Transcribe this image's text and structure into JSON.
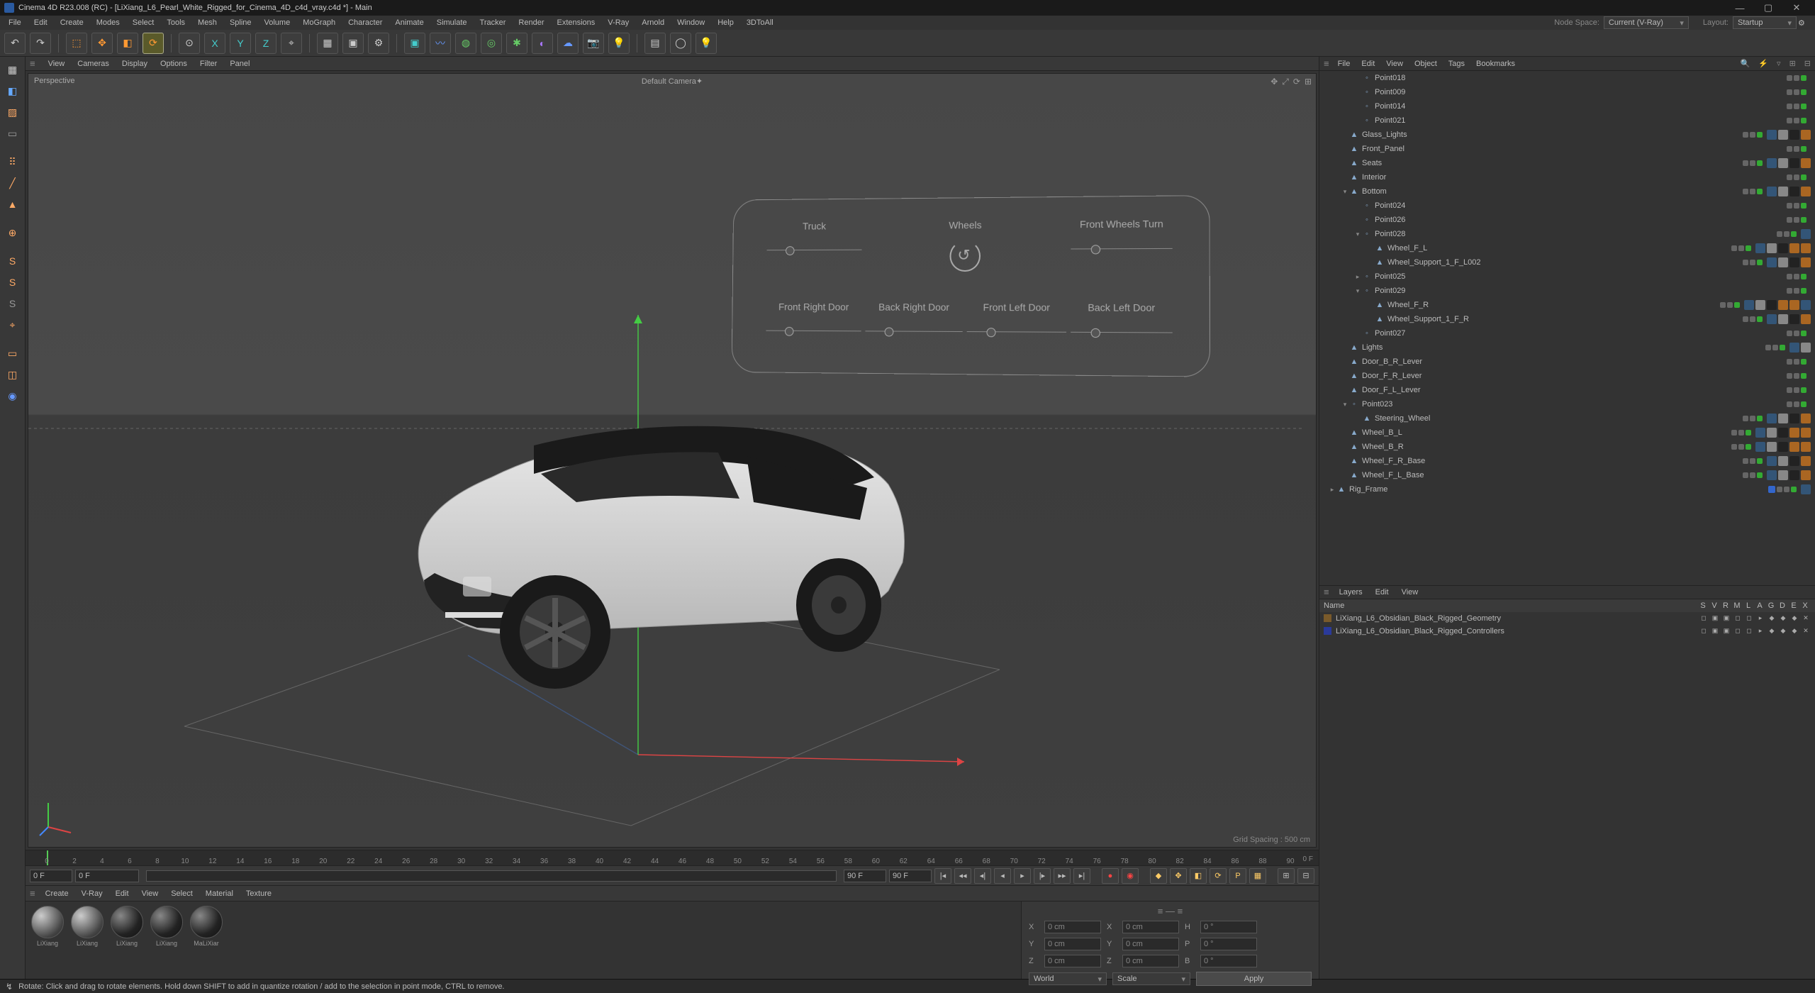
{
  "titlebar": {
    "title": "Cinema 4D R23.008 (RC) - [LiXiang_L6_Pearl_White_Rigged_for_Cinema_4D_c4d_vray.c4d *] - Main"
  },
  "menu": {
    "items": [
      "File",
      "Edit",
      "Create",
      "Modes",
      "Select",
      "Tools",
      "Mesh",
      "Spline",
      "Volume",
      "MoGraph",
      "Character",
      "Animate",
      "Simulate",
      "Tracker",
      "Render",
      "Extensions",
      "V-Ray",
      "Arnold",
      "Window",
      "Help",
      "3DToAll"
    ],
    "node_space_lbl": "Node Space:",
    "node_space_val": "Current (V-Ray)",
    "layout_lbl": "Layout:",
    "layout_val": "Startup"
  },
  "vp_menu": {
    "items": [
      "View",
      "Cameras",
      "Display",
      "Options",
      "Filter",
      "Panel"
    ]
  },
  "viewport": {
    "label": "Perspective",
    "camera": "Default Camera✦",
    "grid": "Grid Spacing : 500 cm"
  },
  "hud": {
    "r0": [
      "Truck",
      "Wheels",
      "Front Wheels Turn"
    ],
    "r1": [
      "Front Right Door",
      "Back Right Door",
      "Front Left Door",
      "Back Left Door"
    ]
  },
  "timeline": {
    "start": "0 F",
    "startb": "0 F",
    "end": "90 F",
    "endb": "90 F",
    "endlabel": "0 F",
    "ticks": [
      0,
      2,
      4,
      6,
      8,
      10,
      12,
      14,
      16,
      18,
      20,
      22,
      24,
      26,
      28,
      30,
      32,
      34,
      36,
      38,
      40,
      42,
      44,
      46,
      48,
      50,
      52,
      54,
      56,
      58,
      60,
      62,
      64,
      66,
      68,
      70,
      72,
      74,
      76,
      78,
      80,
      82,
      84,
      86,
      88,
      90
    ]
  },
  "mat_menu": {
    "items": [
      "Create",
      "V-Ray",
      "Edit",
      "View",
      "Select",
      "Material",
      "Texture"
    ]
  },
  "materials": [
    {
      "name": "LiXiang",
      "cls": ""
    },
    {
      "name": "LiXiang",
      "cls": ""
    },
    {
      "name": "LiXiang",
      "cls": "dark"
    },
    {
      "name": "LiXiang",
      "cls": "dark"
    },
    {
      "name": "MaLiXiar",
      "cls": "dark"
    }
  ],
  "coords": {
    "x": "0 cm",
    "y": "0 cm",
    "z": "0 cm",
    "sx": "0 cm",
    "sy": "0 cm",
    "sz": "0 cm",
    "h": "0 °",
    "p": "0 °",
    "b": "0 °",
    "mode1": "World",
    "mode2": "Scale",
    "apply": "Apply"
  },
  "om_menu": {
    "items": [
      "File",
      "Edit",
      "View",
      "Object",
      "Tags",
      "Bookmarks"
    ]
  },
  "objects": [
    {
      "d": 2,
      "tw": "",
      "ic": "◦",
      "nm": "Point018",
      "tags": []
    },
    {
      "d": 2,
      "tw": "",
      "ic": "◦",
      "nm": "Point009",
      "tags": []
    },
    {
      "d": 2,
      "tw": "",
      "ic": "◦",
      "nm": "Point014",
      "tags": []
    },
    {
      "d": 2,
      "tw": "",
      "ic": "◦",
      "nm": "Point021",
      "tags": []
    },
    {
      "d": 1,
      "tw": "",
      "ic": "▲",
      "nm": "Glass_Lights",
      "tags": [
        "b",
        "w",
        "k",
        "o"
      ]
    },
    {
      "d": 1,
      "tw": "",
      "ic": "▲",
      "nm": "Front_Panel",
      "tags": []
    },
    {
      "d": 1,
      "tw": "",
      "ic": "▲",
      "nm": "Seats",
      "tags": [
        "b",
        "w",
        "k",
        "o"
      ]
    },
    {
      "d": 1,
      "tw": "",
      "ic": "▲",
      "nm": "Interior",
      "tags": []
    },
    {
      "d": 1,
      "tw": "▾",
      "ic": "▲",
      "nm": "Bottom",
      "tags": [
        "b",
        "w",
        "k",
        "o"
      ]
    },
    {
      "d": 2,
      "tw": "",
      "ic": "◦",
      "nm": "Point024",
      "tags": []
    },
    {
      "d": 2,
      "tw": "",
      "ic": "◦",
      "nm": "Point026",
      "tags": []
    },
    {
      "d": 2,
      "tw": "▾",
      "ic": "◦",
      "nm": "Point028",
      "tags": [
        "b"
      ]
    },
    {
      "d": 3,
      "tw": "",
      "ic": "▲",
      "nm": "Wheel_F_L",
      "tags": [
        "b",
        "w",
        "k",
        "o",
        "o"
      ]
    },
    {
      "d": 3,
      "tw": "",
      "ic": "▲",
      "nm": "Wheel_Support_1_F_L002",
      "tags": [
        "b",
        "w",
        "k",
        "o"
      ]
    },
    {
      "d": 2,
      "tw": "▸",
      "ic": "◦",
      "nm": "Point025",
      "tags": []
    },
    {
      "d": 2,
      "tw": "▾",
      "ic": "◦",
      "nm": "Point029",
      "tags": []
    },
    {
      "d": 3,
      "tw": "",
      "ic": "▲",
      "nm": "Wheel_F_R",
      "tags": [
        "b",
        "w",
        "k",
        "o",
        "o",
        "b"
      ]
    },
    {
      "d": 3,
      "tw": "",
      "ic": "▲",
      "nm": "Wheel_Support_1_F_R",
      "tags": [
        "b",
        "w",
        "k",
        "o"
      ]
    },
    {
      "d": 2,
      "tw": "",
      "ic": "◦",
      "nm": "Point027",
      "tags": []
    },
    {
      "d": 1,
      "tw": "",
      "ic": "▲",
      "nm": "Lights",
      "tags": [
        "b",
        "w"
      ]
    },
    {
      "d": 1,
      "tw": "",
      "ic": "▲",
      "nm": "Door_B_R_Lever",
      "tags": []
    },
    {
      "d": 1,
      "tw": "",
      "ic": "▲",
      "nm": "Door_F_R_Lever",
      "tags": []
    },
    {
      "d": 1,
      "tw": "",
      "ic": "▲",
      "nm": "Door_F_L_Lever",
      "tags": []
    },
    {
      "d": 1,
      "tw": "▾",
      "ic": "◦",
      "nm": "Point023",
      "tags": []
    },
    {
      "d": 2,
      "tw": "",
      "ic": "▲",
      "nm": "Steering_Wheel",
      "tags": [
        "b",
        "w",
        "k",
        "o"
      ]
    },
    {
      "d": 1,
      "tw": "",
      "ic": "▲",
      "nm": "Wheel_B_L",
      "tags": [
        "b",
        "w",
        "k",
        "o",
        "o"
      ]
    },
    {
      "d": 1,
      "tw": "",
      "ic": "▲",
      "nm": "Wheel_B_R",
      "tags": [
        "b",
        "w",
        "k",
        "o",
        "o"
      ]
    },
    {
      "d": 1,
      "tw": "",
      "ic": "▲",
      "nm": "Wheel_F_R_Base",
      "tags": [
        "b",
        "w",
        "k",
        "o"
      ]
    },
    {
      "d": 1,
      "tw": "",
      "ic": "▲",
      "nm": "Wheel_F_L_Base",
      "tags": [
        "b",
        "w",
        "k",
        "o"
      ]
    },
    {
      "d": 0,
      "tw": "▸",
      "ic": "▲",
      "nm": "Rig_Frame",
      "tags": [
        "b"
      ],
      "blue": true
    }
  ],
  "layers_menu": {
    "items": [
      "Layers",
      "Edit",
      "View"
    ]
  },
  "layers_cols": [
    "S",
    "V",
    "R",
    "M",
    "L",
    "A",
    "G",
    "D",
    "E",
    "X"
  ],
  "layers": [
    {
      "color": "#7a5a2a",
      "name": "LiXiang_L6_Obsidian_Black_Rigged_Geometry"
    },
    {
      "color": "#2a3a9a",
      "name": "LiXiang_L6_Obsidian_Black_Rigged_Controllers"
    }
  ],
  "status": {
    "hint": "Rotate: Click and drag to rotate elements. Hold down SHIFT to add in quantize rotation / add to the selection in point mode, CTRL to remove."
  },
  "layers_header_name": "Name"
}
